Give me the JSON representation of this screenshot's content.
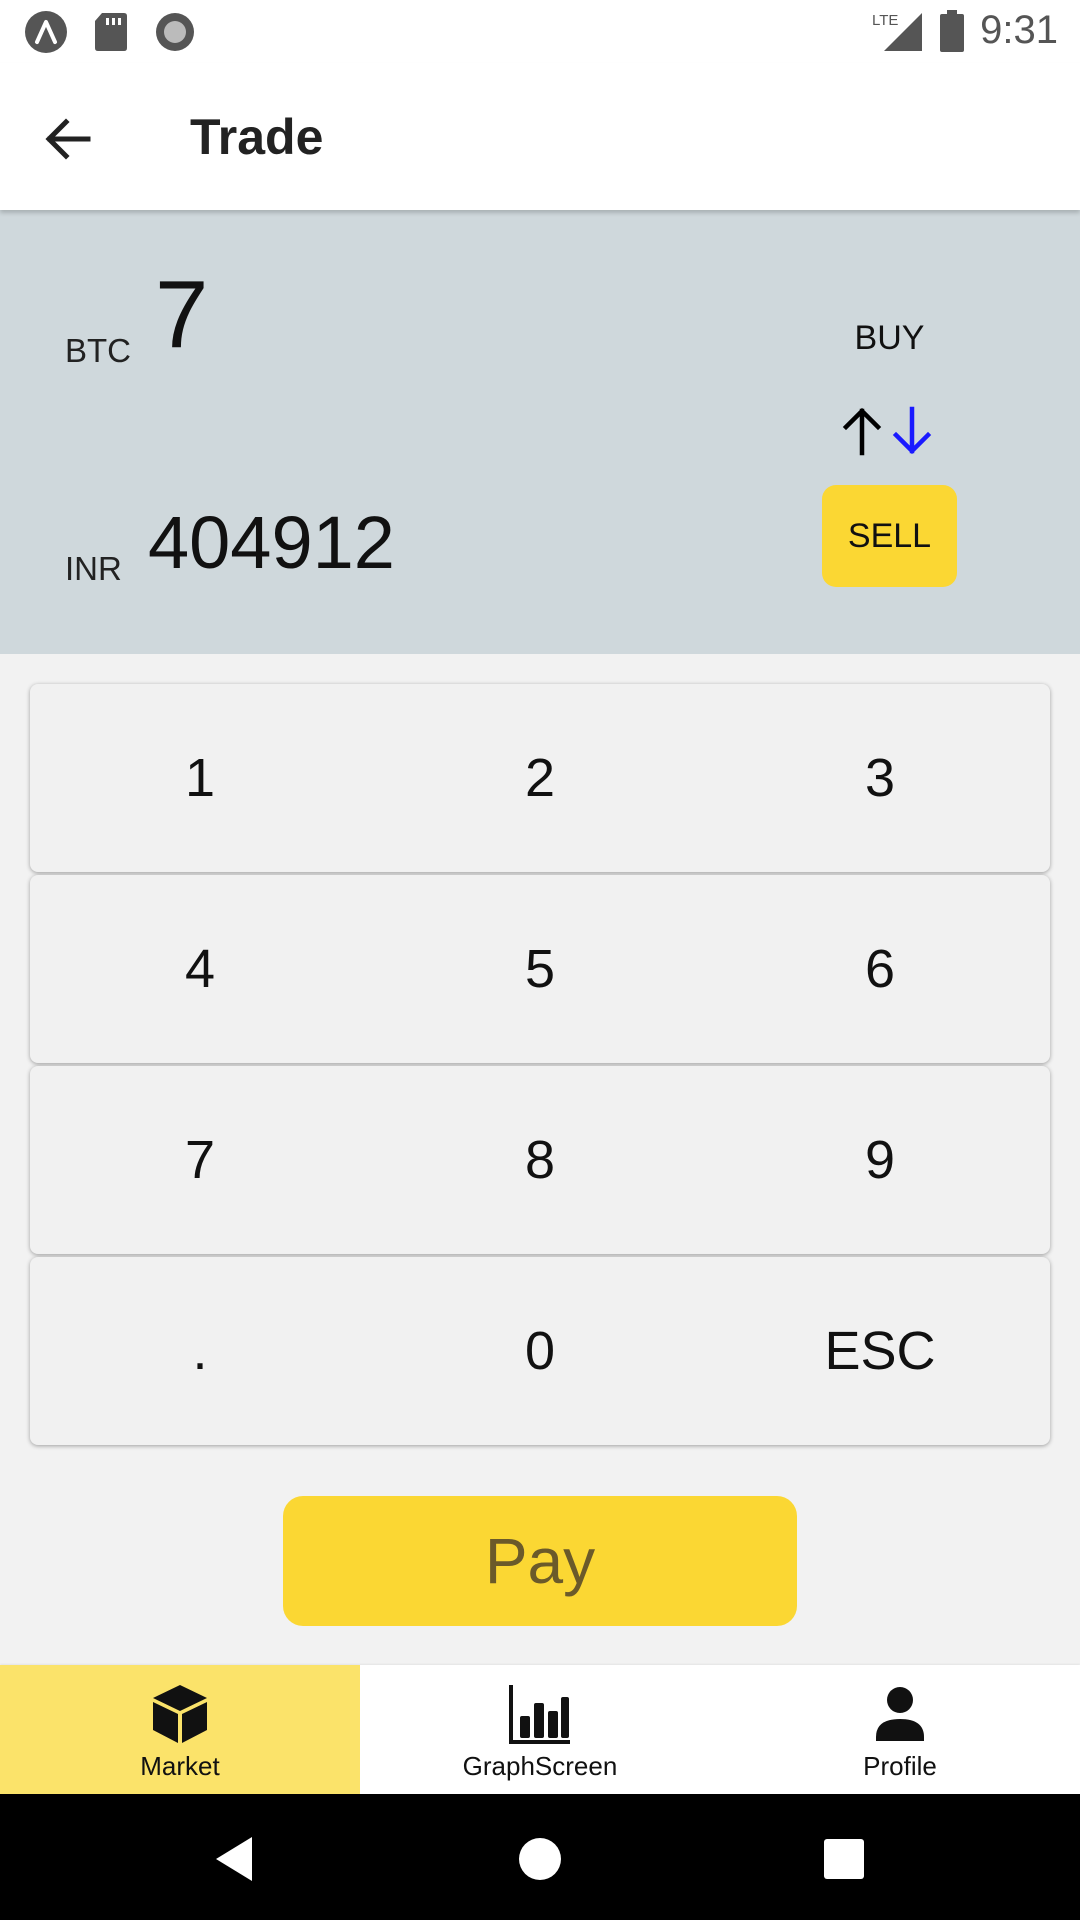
{
  "status_bar": {
    "time": "9:31",
    "network_label": "LTE",
    "icons": [
      "app-a-icon",
      "sd-card-icon",
      "record-icon",
      "signal-icon",
      "battery-icon"
    ]
  },
  "app_bar": {
    "title": "Trade",
    "back_icon": "arrow-back-icon"
  },
  "trade": {
    "btc_label": "BTC",
    "btc_value": "7",
    "inr_label": "INR",
    "inr_value": "404912",
    "buy_label": "BUY",
    "sell_label": "SELL",
    "arrow_up_color": "#000000",
    "arrow_down_color": "#1a1aff"
  },
  "keypad": {
    "rows": [
      [
        "1",
        "2",
        "3"
      ],
      [
        "4",
        "5",
        "6"
      ],
      [
        "7",
        "8",
        "9"
      ],
      [
        ".",
        "0",
        "ESC"
      ]
    ]
  },
  "pay": {
    "label": "Pay"
  },
  "bottom_nav": {
    "items": [
      {
        "label": "Market",
        "icon": "cube-icon",
        "active": true
      },
      {
        "label": "GraphScreen",
        "icon": "bar-chart-icon",
        "active": false
      },
      {
        "label": "Profile",
        "icon": "person-icon",
        "active": false
      }
    ]
  },
  "colors": {
    "accent": "#fbd733",
    "nav_active": "#fbe36a",
    "panel": "#cfd8dc"
  }
}
